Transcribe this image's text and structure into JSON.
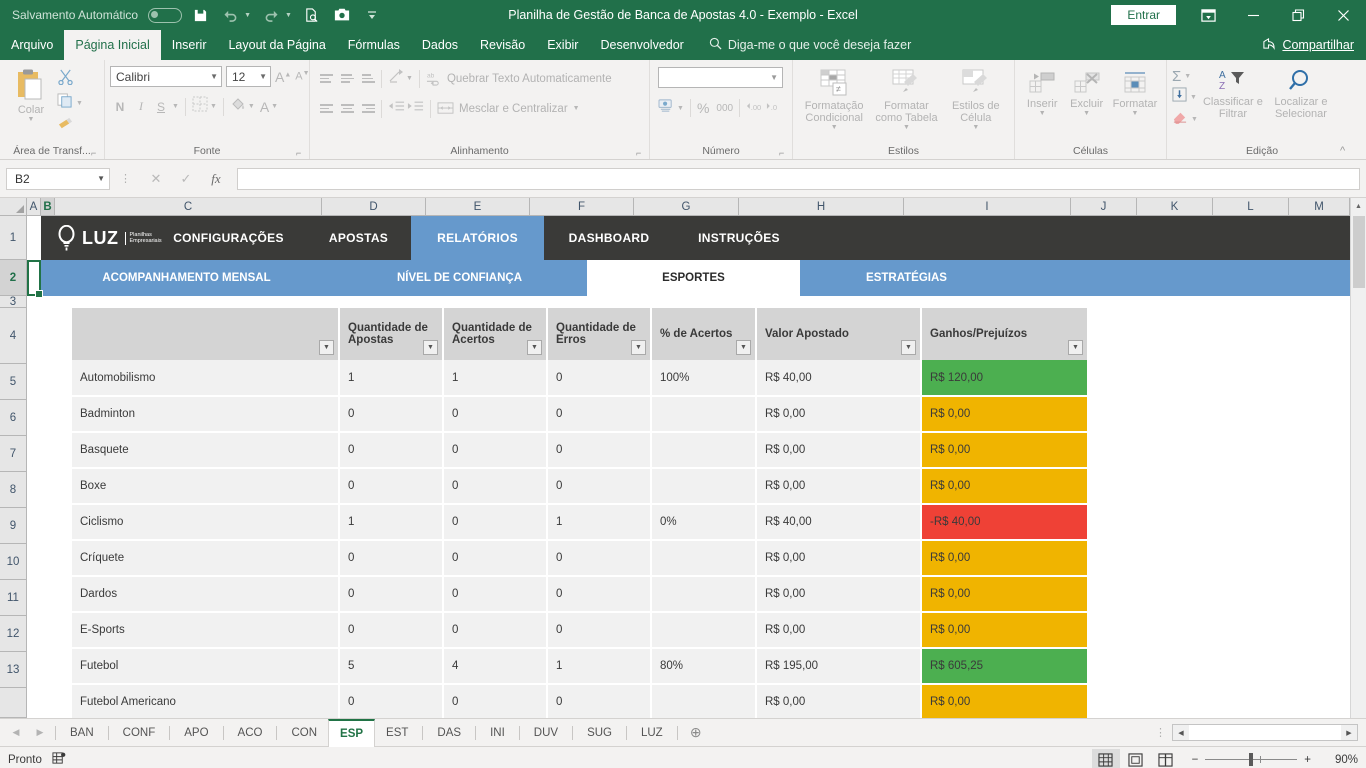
{
  "titlebar": {
    "autosave_label": "Salvamento Automático",
    "autosave_state": "off",
    "quick_access": [
      "save-icon",
      "undo-icon",
      "redo-icon",
      "print-preview-icon",
      "camera-icon",
      "customize-icon"
    ],
    "title": "Planilha de Gestão de Banca de Apostas 4.0 - Exemplo  -  Excel",
    "signin_label": "Entrar",
    "ribbon_display_icon": "ribbon-display-options-icon",
    "minimize_icon": "minimize-icon",
    "restore_icon": "restore-icon",
    "close_icon": "close-icon"
  },
  "ribbon_tabs": {
    "items": [
      {
        "label": "Arquivo",
        "active": false
      },
      {
        "label": "Página Inicial",
        "active": true
      },
      {
        "label": "Inserir",
        "active": false
      },
      {
        "label": "Layout da Página",
        "active": false
      },
      {
        "label": "Fórmulas",
        "active": false
      },
      {
        "label": "Dados",
        "active": false
      },
      {
        "label": "Revisão",
        "active": false
      },
      {
        "label": "Exibir",
        "active": false
      },
      {
        "label": "Desenvolvedor",
        "active": false
      }
    ],
    "tellme_placeholder": "Diga-me o que você deseja fazer",
    "share_label": "Compartilhar"
  },
  "ribbon": {
    "clipboard": {
      "group_label": "Área de Transf...",
      "paste_label": "Colar",
      "cut_label": "cut-icon",
      "copy_label": "copy-icon",
      "format_painter_label": "format-painter-icon"
    },
    "font": {
      "group_label": "Fonte",
      "font_family": "Calibri",
      "font_size": "12",
      "bold": "N",
      "italic": "I",
      "underline": "S"
    },
    "alignment": {
      "group_label": "Alinhamento",
      "wrap_text": "Quebrar Texto Automaticamente",
      "merge_center": "Mesclar e Centralizar"
    },
    "number": {
      "group_label": "Número",
      "format_value": "",
      "percent": "%",
      "thousands": "000"
    },
    "styles": {
      "group_label": "Estilos",
      "conditional": "Formatação Condicional",
      "table": "Formatar como Tabela",
      "cell": "Estilos de Célula"
    },
    "cells": {
      "group_label": "Células",
      "insert": "Inserir",
      "delete": "Excluir",
      "format": "Formatar"
    },
    "editing": {
      "group_label": "Edição",
      "sort_filter": "Classificar e Filtrar",
      "find_select": "Localizar e Selecionar"
    }
  },
  "formula_bar": {
    "name_box": "B2",
    "cancel_icon": "cancel-icon",
    "confirm_icon": "confirm-icon",
    "function_icon": "fx",
    "formula_value": ""
  },
  "grid": {
    "columns": [
      "A",
      "B",
      "C",
      "D",
      "E",
      "F",
      "G",
      "H",
      "I",
      "J",
      "K",
      "L",
      "M"
    ],
    "selected_column": "B",
    "rows": [
      "1",
      "2",
      "3",
      "4",
      "5",
      "6",
      "7",
      "8",
      "9",
      "10",
      "11",
      "12",
      "13"
    ],
    "selected_row": "2",
    "active_cell": "B2"
  },
  "nav_primary": {
    "logo_text": "LUZ",
    "logo_sub_line1": "Planilhas",
    "logo_sub_line2": "Empresariais",
    "items": [
      {
        "label": "CONFIGURAÇÕES",
        "active": false
      },
      {
        "label": "APOSTAS",
        "active": false
      },
      {
        "label": "RELATÓRIOS",
        "active": true
      },
      {
        "label": "DASHBOARD",
        "active": false
      },
      {
        "label": "INSTRUÇÕES",
        "active": false
      }
    ]
  },
  "nav_secondary": {
    "items": [
      {
        "label": "ACOMPANHAMENTO MENSAL",
        "active": false
      },
      {
        "label": "NÍVEL DE CONFIANÇA",
        "active": false
      },
      {
        "label": "ESPORTES",
        "active": true
      },
      {
        "label": "ESTRATÉGIAS",
        "active": false
      }
    ]
  },
  "table": {
    "headers": [
      "",
      "Quantidade de Apostas",
      "Quantidade de Acertos",
      "Quantidade de Erros",
      "% de Acertos",
      "Valor Apostado",
      "Ganhos/Prejuízos"
    ],
    "rows": [
      {
        "sport": "Automobilismo",
        "apostas": "1",
        "acertos": "1",
        "erros": "0",
        "pct": "100%",
        "valor": "R$ 40,00",
        "ganhos": "R$ 120,00",
        "status": "pos"
      },
      {
        "sport": "Badminton",
        "apostas": "0",
        "acertos": "0",
        "erros": "0",
        "pct": "",
        "valor": "R$ 0,00",
        "ganhos": "R$ 0,00",
        "status": "neu"
      },
      {
        "sport": "Basquete",
        "apostas": "0",
        "acertos": "0",
        "erros": "0",
        "pct": "",
        "valor": "R$ 0,00",
        "ganhos": "R$ 0,00",
        "status": "neu"
      },
      {
        "sport": "Boxe",
        "apostas": "0",
        "acertos": "0",
        "erros": "0",
        "pct": "",
        "valor": "R$ 0,00",
        "ganhos": "R$ 0,00",
        "status": "neu"
      },
      {
        "sport": "Ciclismo",
        "apostas": "1",
        "acertos": "0",
        "erros": "1",
        "pct": "0%",
        "valor": "R$ 40,00",
        "ganhos": "-R$ 40,00",
        "status": "neg"
      },
      {
        "sport": "Críquete",
        "apostas": "0",
        "acertos": "0",
        "erros": "0",
        "pct": "",
        "valor": "R$ 0,00",
        "ganhos": "R$ 0,00",
        "status": "neu"
      },
      {
        "sport": "Dardos",
        "apostas": "0",
        "acertos": "0",
        "erros": "0",
        "pct": "",
        "valor": "R$ 0,00",
        "ganhos": "R$ 0,00",
        "status": "neu"
      },
      {
        "sport": "E-Sports",
        "apostas": "0",
        "acertos": "0",
        "erros": "0",
        "pct": "",
        "valor": "R$ 0,00",
        "ganhos": "R$ 0,00",
        "status": "neu"
      },
      {
        "sport": "Futebol",
        "apostas": "5",
        "acertos": "4",
        "erros": "1",
        "pct": "80%",
        "valor": "R$ 195,00",
        "ganhos": "R$ 605,25",
        "status": "pos"
      },
      {
        "sport": "Futebol Americano",
        "apostas": "0",
        "acertos": "0",
        "erros": "0",
        "pct": "",
        "valor": "R$ 0,00",
        "ganhos": "R$ 0,00",
        "status": "neu"
      }
    ],
    "colors": {
      "positive": "#4caf50",
      "neutral": "#f0b400",
      "negative": "#ef4136",
      "header_bg": "#d4d4d4",
      "sport_bg": "#d9d9d9",
      "cell_bg": "#f1f1f1"
    }
  },
  "sheet_tabs": {
    "items": [
      {
        "label": "BAN",
        "active": false
      },
      {
        "label": "CONF",
        "active": false
      },
      {
        "label": "APO",
        "active": false
      },
      {
        "label": "ACO",
        "active": false
      },
      {
        "label": "CON",
        "active": false
      },
      {
        "label": "ESP",
        "active": true
      },
      {
        "label": "EST",
        "active": false
      },
      {
        "label": "DAS",
        "active": false
      },
      {
        "label": "INI",
        "active": false
      },
      {
        "label": "DUV",
        "active": false
      },
      {
        "label": "SUG",
        "active": false
      },
      {
        "label": "LUZ",
        "active": false
      }
    ],
    "add_sheet_icon": "add-sheet-icon"
  },
  "statusbar": {
    "status_text": "Pronto",
    "accessibility_icon": "accessibility-icon",
    "views": [
      "normal-view-icon",
      "page-layout-view-icon",
      "page-break-view-icon"
    ],
    "active_view": "normal-view-icon",
    "zoom_out": "−",
    "zoom_in": "+",
    "zoom_level": "90%"
  },
  "theme": {
    "excel_green": "#21704a",
    "accent_blue": "#6699cc",
    "nav_dark": "#3a3a38"
  }
}
